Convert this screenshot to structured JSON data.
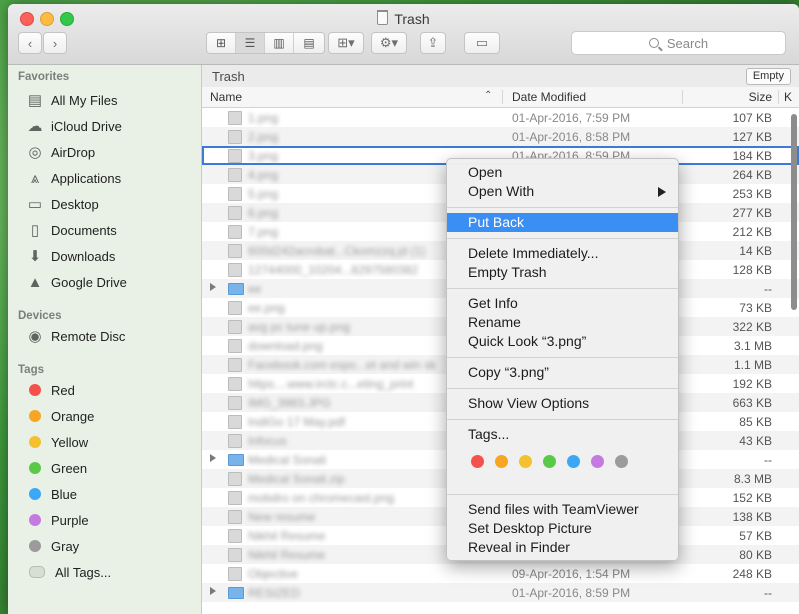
{
  "window": {
    "title": "Trash"
  },
  "toolbar": {
    "search_placeholder": "Search"
  },
  "sidebar": {
    "favorites_heading": "Favorites",
    "favorites": [
      {
        "label": "All My Files",
        "icon": "all-files-icon"
      },
      {
        "label": "iCloud Drive",
        "icon": "cloud-icon"
      },
      {
        "label": "AirDrop",
        "icon": "airdrop-icon"
      },
      {
        "label": "Applications",
        "icon": "applications-icon"
      },
      {
        "label": "Desktop",
        "icon": "desktop-icon"
      },
      {
        "label": "Documents",
        "icon": "documents-icon"
      },
      {
        "label": "Downloads",
        "icon": "downloads-icon"
      },
      {
        "label": "Google Drive",
        "icon": "google-drive-icon"
      }
    ],
    "devices_heading": "Devices",
    "devices": [
      {
        "label": "Remote Disc",
        "icon": "disc-icon"
      }
    ],
    "tags_heading": "Tags",
    "tags": [
      {
        "label": "Red",
        "color": "#f5514c"
      },
      {
        "label": "Orange",
        "color": "#f5a623"
      },
      {
        "label": "Yellow",
        "color": "#f5c02f"
      },
      {
        "label": "Green",
        "color": "#5ac94a"
      },
      {
        "label": "Blue",
        "color": "#3ba7f5"
      },
      {
        "label": "Purple",
        "color": "#c57ae0"
      },
      {
        "label": "Gray",
        "color": "#9b9b9b"
      },
      {
        "label": "All Tags...",
        "color": "#d7dfd5"
      }
    ]
  },
  "content": {
    "path_label": "Trash",
    "empty_button": "Empty",
    "columns": {
      "name": "Name",
      "date": "Date Modified",
      "size": "Size",
      "kind": "K"
    },
    "rows": [
      {
        "name": "1.png",
        "date": "01-Apr-2016, 7:59 PM",
        "size": "107 KB"
      },
      {
        "name": "2.png",
        "date": "01-Apr-2016, 8:58 PM",
        "size": "127 KB"
      },
      {
        "name": "3.png",
        "date": "01-Apr-2016, 8:59 PM",
        "size": "184 KB"
      },
      {
        "name": "4.png",
        "date": "",
        "size": "264 KB"
      },
      {
        "name": "5.png",
        "date": "",
        "size": "253 KB"
      },
      {
        "name": "6.png",
        "date": "",
        "size": "277 KB"
      },
      {
        "name": "7.png",
        "date": "",
        "size": "212 KB"
      },
      {
        "name": "600d242acrobat...Ckomzzq.jd (1)",
        "date": "",
        "size": "14 KB"
      },
      {
        "name": "12744000_10204...8297580382",
        "date": "",
        "size": "128 KB"
      },
      {
        "name": "ee",
        "date": "",
        "size": "--"
      },
      {
        "name": "ee.png",
        "date": "",
        "size": "73 KB"
      },
      {
        "name": "avg pc tune up.png",
        "date": "",
        "size": "322 KB"
      },
      {
        "name": "download.png",
        "date": "",
        "size": "3.1 MB"
      },
      {
        "name": "Facebook.com espo...et and win sk",
        "date": "",
        "size": "1.1 MB"
      },
      {
        "name": "https....www.irctc.c...eting_print",
        "date": "",
        "size": "192 KB"
      },
      {
        "name": "IMG_3983.JPG",
        "date": "",
        "size": "663 KB"
      },
      {
        "name": "IndiGo 17 May.pdf",
        "date": "",
        "size": "85 KB"
      },
      {
        "name": "Infocus",
        "date": "",
        "size": "43 KB"
      },
      {
        "name": "Medical Sonali",
        "date": "",
        "size": "--"
      },
      {
        "name": "Medical Sonali.zip",
        "date": "",
        "size": "8.3 MB"
      },
      {
        "name": "mobdro on chromecast.png",
        "date": "",
        "size": "152 KB"
      },
      {
        "name": "New resume",
        "date": "",
        "size": "138 KB"
      },
      {
        "name": "Nikhil Resume",
        "date": "",
        "size": "57 KB"
      },
      {
        "name": "Nikhil Resume",
        "date": "",
        "size": "80 KB"
      },
      {
        "name": "Objective",
        "date": "09-Apr-2016, 1:54 PM",
        "size": "248 KB"
      },
      {
        "name": "RESIZED",
        "date": "01-Apr-2016, 8:59 PM",
        "size": "--"
      }
    ]
  },
  "context_menu": {
    "items": [
      {
        "label": "Open"
      },
      {
        "label": "Open With"
      },
      {
        "label": "Put Back"
      },
      {
        "label": "Delete Immediately..."
      },
      {
        "label": "Empty Trash"
      },
      {
        "label": "Get Info"
      },
      {
        "label": "Rename"
      },
      {
        "label": "Quick Look “3.png”"
      },
      {
        "label": "Copy “3.png”"
      },
      {
        "label": "Show View Options"
      },
      {
        "label": "Tags..."
      },
      {
        "label": "Send files with TeamViewer"
      },
      {
        "label": "Set Desktop Picture"
      },
      {
        "label": "Reveal in Finder"
      }
    ],
    "tag_colors": [
      "#f5514c",
      "#f5a623",
      "#f5c02f",
      "#5ac94a",
      "#3ba7f5",
      "#c57ae0",
      "#9b9b9b"
    ]
  }
}
